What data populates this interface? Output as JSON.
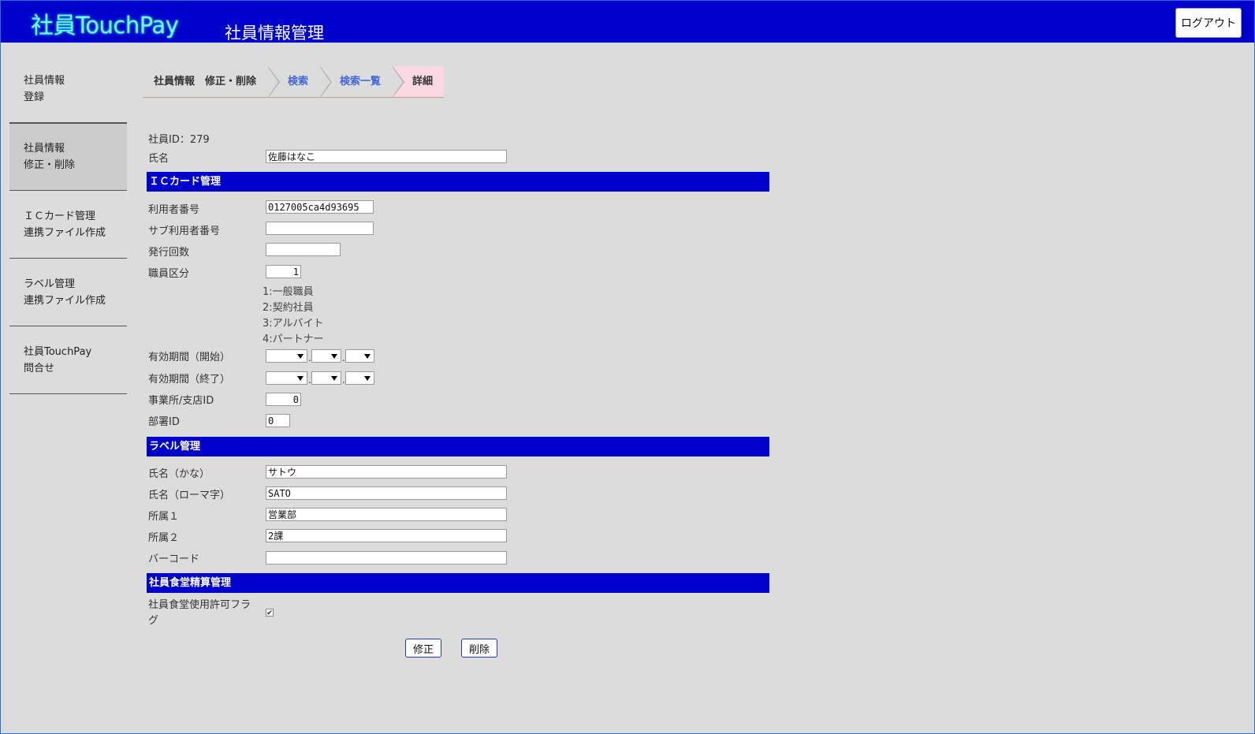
{
  "header": {
    "logo": "社員TouchPay",
    "title": "社員情報管理",
    "logout_label": "ログアウト"
  },
  "sidebar": {
    "items": [
      {
        "line1": "社員情報",
        "line2": "登録"
      },
      {
        "line1": "社員情報",
        "line2": "修正・削除"
      },
      {
        "line1": "ＩＣカード管理",
        "line2": "連携ファイル作成"
      },
      {
        "line1": "ラベル管理",
        "line2": "連携ファイル作成"
      },
      {
        "line1": "社員TouchPay",
        "line2": "問合せ"
      }
    ]
  },
  "breadcrumb": [
    "社員情報　修正・削除",
    "検索",
    "検索一覧",
    "詳細"
  ],
  "employee": {
    "id_label": "社員ID：279",
    "name_label": "氏名",
    "name_value": "佐藤はなこ"
  },
  "ic_section": {
    "title": "ＩＣカード管理",
    "user_no_label": "利用者番号",
    "user_no_value": "0127005ca4d93695",
    "sub_user_no_label": "サブ利用者番号",
    "sub_user_no_value": "",
    "issue_count_label": "発行回数",
    "issue_count_value": "",
    "staff_type_label": "職員区分",
    "staff_type_value": "1",
    "staff_type_notes": [
      "1:一般職員",
      "2:契約社員",
      "3:アルバイト",
      "4:パートナー"
    ],
    "valid_start_label": "有効期間（開始）",
    "valid_end_label": "有効期間（終了）",
    "office_id_label": "事業所/支店ID",
    "office_id_value": "0",
    "dept_id_label": "部署ID",
    "dept_id_value": "0"
  },
  "label_section": {
    "title": "ラベル管理",
    "kana_label": "氏名（かな）",
    "kana_value": "サトウ",
    "romaji_label": "氏名（ローマ字）",
    "romaji_value": "SATO",
    "aff1_label": "所属１",
    "aff1_value": "営業部",
    "aff2_label": "所属２",
    "aff2_value": "2課",
    "barcode_label": "バーコード",
    "barcode_value": ""
  },
  "cafeteria_section": {
    "title": "社員食堂精算管理",
    "flag_label_1": "社員食堂使用許可フラ",
    "flag_label_2": "グ",
    "flag_checked": true
  },
  "actions": {
    "update_label": "修正",
    "delete_label": "削除"
  },
  "colors": {
    "header_bg": "#0000cc",
    "section_bg": "#0000cc",
    "crumb_current_bg": "#fcd8e4",
    "crumb_link": "#4466dd"
  }
}
